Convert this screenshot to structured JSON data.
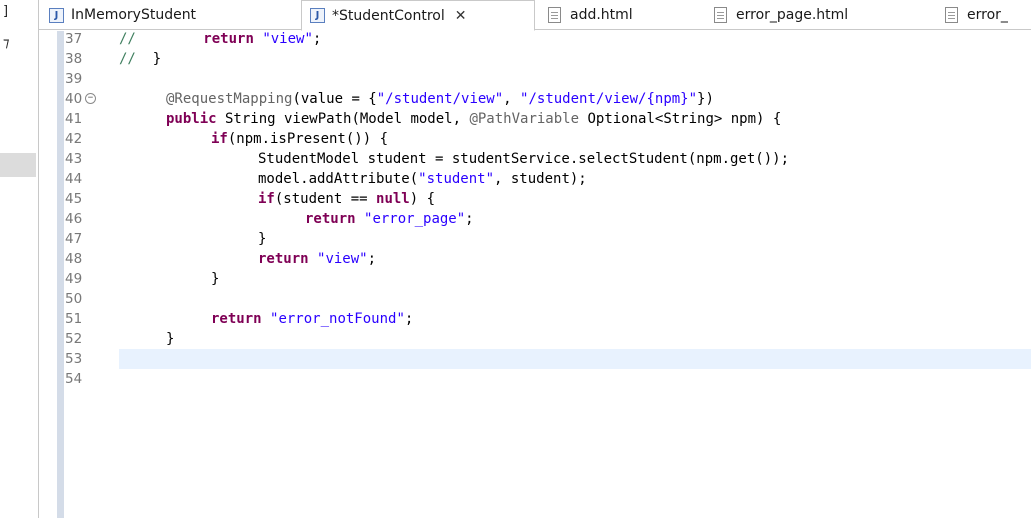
{
  "left_panel": {
    "glyph_top": "]",
    "glyph_second": "⁊"
  },
  "tabs": [
    {
      "label": "InMemoryStudent",
      "icon": "java-file-icon",
      "active": false
    },
    {
      "label": "*StudentControl",
      "icon": "java-file-icon",
      "active": true,
      "close": "✕"
    },
    {
      "label": "add.html",
      "icon": "html-file-icon",
      "active": false
    },
    {
      "label": "error_page.html",
      "icon": "html-file-icon",
      "active": false
    },
    {
      "label": "error_",
      "icon": "html-file-icon",
      "active": false
    }
  ],
  "lines": [
    {
      "n": "37"
    },
    {
      "n": "38"
    },
    {
      "n": "39"
    },
    {
      "n": "40"
    },
    {
      "n": "41"
    },
    {
      "n": "42"
    },
    {
      "n": "43"
    },
    {
      "n": "44"
    },
    {
      "n": "45"
    },
    {
      "n": "46"
    },
    {
      "n": "47"
    },
    {
      "n": "48"
    },
    {
      "n": "49"
    },
    {
      "n": "50"
    },
    {
      "n": "51"
    },
    {
      "n": "52"
    },
    {
      "n": "53"
    },
    {
      "n": "54"
    }
  ],
  "code": {
    "l37_cmt": "//",
    "l37_ret": "return",
    "l37_str": "\"view\"",
    "l37_end": ";",
    "l38_cmt": "//",
    "l38_brace": "}",
    "l40_ann": "@RequestMapping",
    "l40_a": "(value = {",
    "l40_s1": "\"/student/view\"",
    "l40_b": ", ",
    "l40_s2": "\"/student/view/{npm}\"",
    "l40_c": "})",
    "l41_kw": "public",
    "l41_a": " String viewPath(Model model, ",
    "l41_ann": "@PathVariable",
    "l41_b": " Optional<String> npm) {",
    "l42_kw": "if",
    "l42_a": "(npm.isPresent()) {",
    "l43": "StudentModel student = studentService.selectStudent(npm.get());",
    "l44_a": "model.addAttribute(",
    "l44_s": "\"student\"",
    "l44_b": ", student);",
    "l45_kw": "if",
    "l45_a": "(student == ",
    "l45_kw2": "null",
    "l45_b": ") {",
    "l46_kw": "return",
    "l46_s": "\"error_page\"",
    "l46_b": ";",
    "l47": "}",
    "l48_kw": "return",
    "l48_s": "\"view\"",
    "l48_b": ";",
    "l49": "}",
    "l51_kw": "return",
    "l51_s": "\"error_notFound\"",
    "l51_b": ";",
    "l52": "}"
  },
  "colors": {
    "keyword": "#7f0055",
    "string": "#2a00ff",
    "annotation": "#646464",
    "comment": "#3f7f5f",
    "current_line": "#e8f2fe"
  },
  "current_line": "53"
}
